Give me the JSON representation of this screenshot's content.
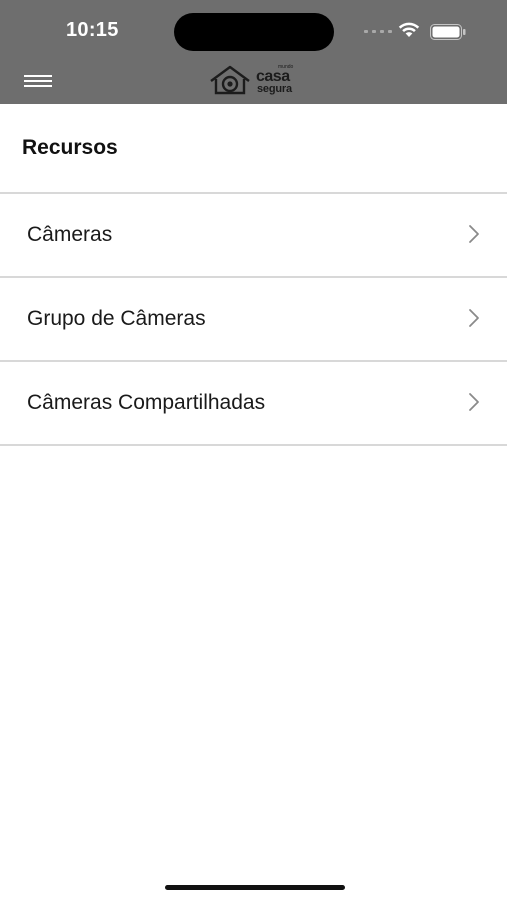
{
  "status_bar": {
    "time": "10:15"
  },
  "header": {
    "menu_icon": "hamburger-icon",
    "logo": {
      "small_text": "mundo",
      "line1": "casa",
      "line2": "segura"
    }
  },
  "section": {
    "title": "Recursos"
  },
  "list": {
    "items": [
      {
        "label": "Câmeras",
        "icon": "chevron-right-icon"
      },
      {
        "label": "Grupo de Câmeras",
        "icon": "chevron-right-icon"
      },
      {
        "label": "Câmeras Compartilhadas",
        "icon": "chevron-right-icon"
      }
    ]
  },
  "colors": {
    "topbar": "#6e6e6e",
    "background": "#ffffff",
    "separator": "#d8d8d8"
  }
}
